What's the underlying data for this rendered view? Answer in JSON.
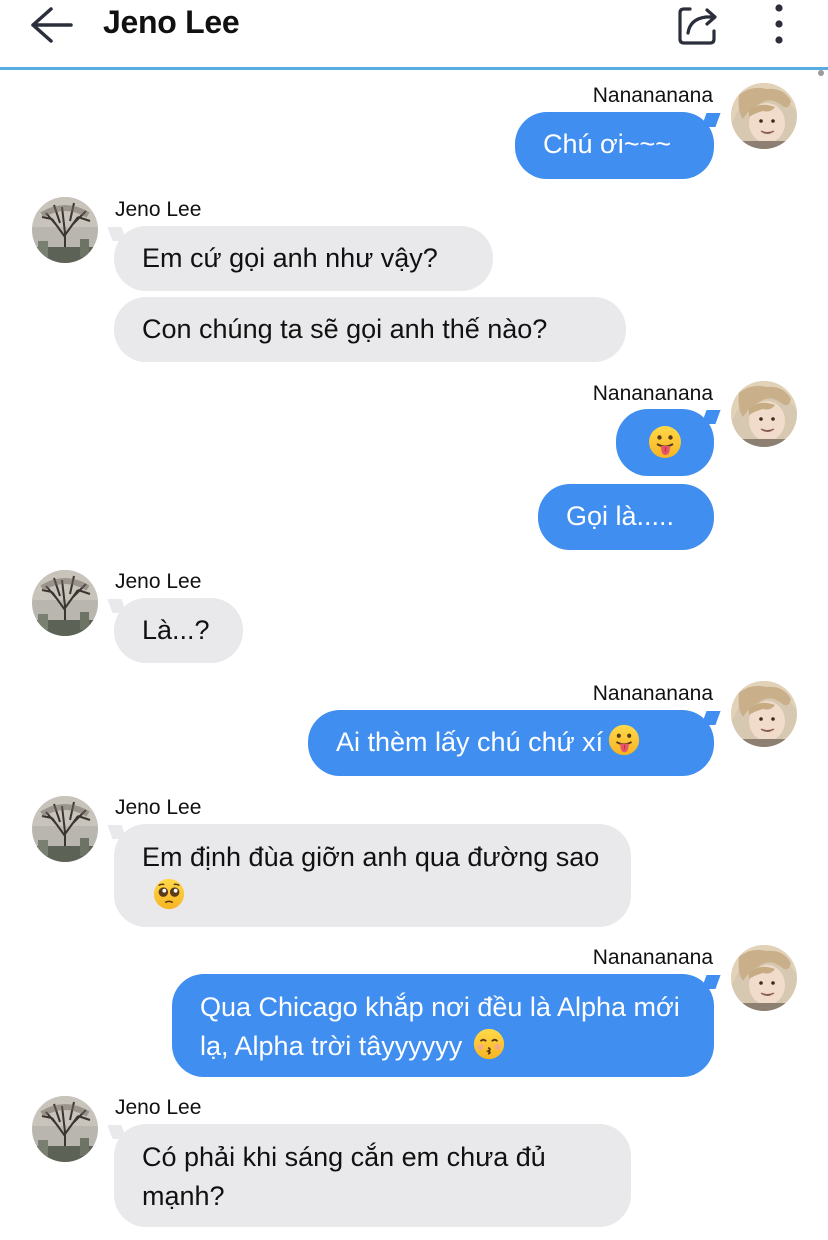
{
  "header": {
    "title": "Jeno Lee",
    "back_icon": "arrow-left-icon",
    "share_icon": "share-icon",
    "more_icon": "more-vertical-icon"
  },
  "colors": {
    "incoming_bubble": "#e9e9eb",
    "outgoing_bubble": "#3f8ef0",
    "header_line": "#58ade0"
  },
  "messages": [
    {
      "sender": "Nanananana",
      "direction": "out",
      "text": "Chú ơi~~~"
    },
    {
      "sender": "Jeno Lee",
      "direction": "in",
      "text": "Em cứ gọi anh như vậy?"
    },
    {
      "sender": "Jeno Lee",
      "direction": "in",
      "text": "Con chúng ta sẽ gọi anh thế nào?"
    },
    {
      "sender": "Nanananana",
      "direction": "out",
      "text": "",
      "emoji": "tongue-out-emoji"
    },
    {
      "sender": "Nanananana",
      "direction": "out",
      "text": "Gọi là....."
    },
    {
      "sender": "Jeno Lee",
      "direction": "in",
      "text": "Là...?"
    },
    {
      "sender": "Nanananana",
      "direction": "out",
      "text": "Ai thèm lấy chú chứ xí",
      "emoji": "tongue-out-emoji"
    },
    {
      "sender": "Jeno Lee",
      "direction": "in",
      "text": "Em định đùa giỡn anh qua đường sao",
      "emoji": "pleading-face-emoji"
    },
    {
      "sender": "Nanananana",
      "direction": "out",
      "text": "Qua Chicago khắp nơi đều là Alpha mới lạ, Alpha trời tâyyyyyy",
      "emoji": "kissing-face-emoji"
    },
    {
      "sender": "Jeno Lee",
      "direction": "in",
      "text": "Có phải khi sáng cắn em chưa đủ mạnh?"
    }
  ]
}
